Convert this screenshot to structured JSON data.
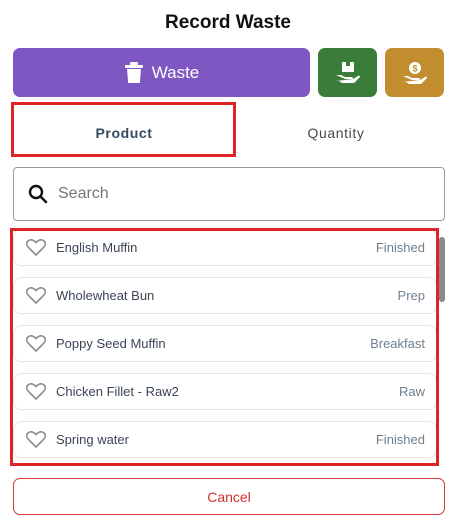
{
  "dialog": {
    "title": "Record Waste"
  },
  "actions": {
    "waste_label": "Waste",
    "colors": {
      "waste": "#7e57c2",
      "green": "#3a7d3a",
      "gold": "#c28d2e"
    },
    "icons": [
      "trash-icon",
      "box-in-hand-icon",
      "coin-in-hand-icon"
    ]
  },
  "tabs": [
    {
      "label": "Product",
      "active": true
    },
    {
      "label": "Quantity",
      "active": false
    }
  ],
  "search": {
    "placeholder": "Search",
    "value": ""
  },
  "products": [
    {
      "name": "English Muffin",
      "category": "Finished"
    },
    {
      "name": "Wholewheat Bun",
      "category": "Prep"
    },
    {
      "name": "Poppy Seed Muffin",
      "category": "Breakfast"
    },
    {
      "name": "Chicken Fillet - Raw2",
      "category": "Raw"
    },
    {
      "name": "Spring water",
      "category": "Finished"
    }
  ],
  "footer": {
    "cancel_label": "Cancel"
  }
}
